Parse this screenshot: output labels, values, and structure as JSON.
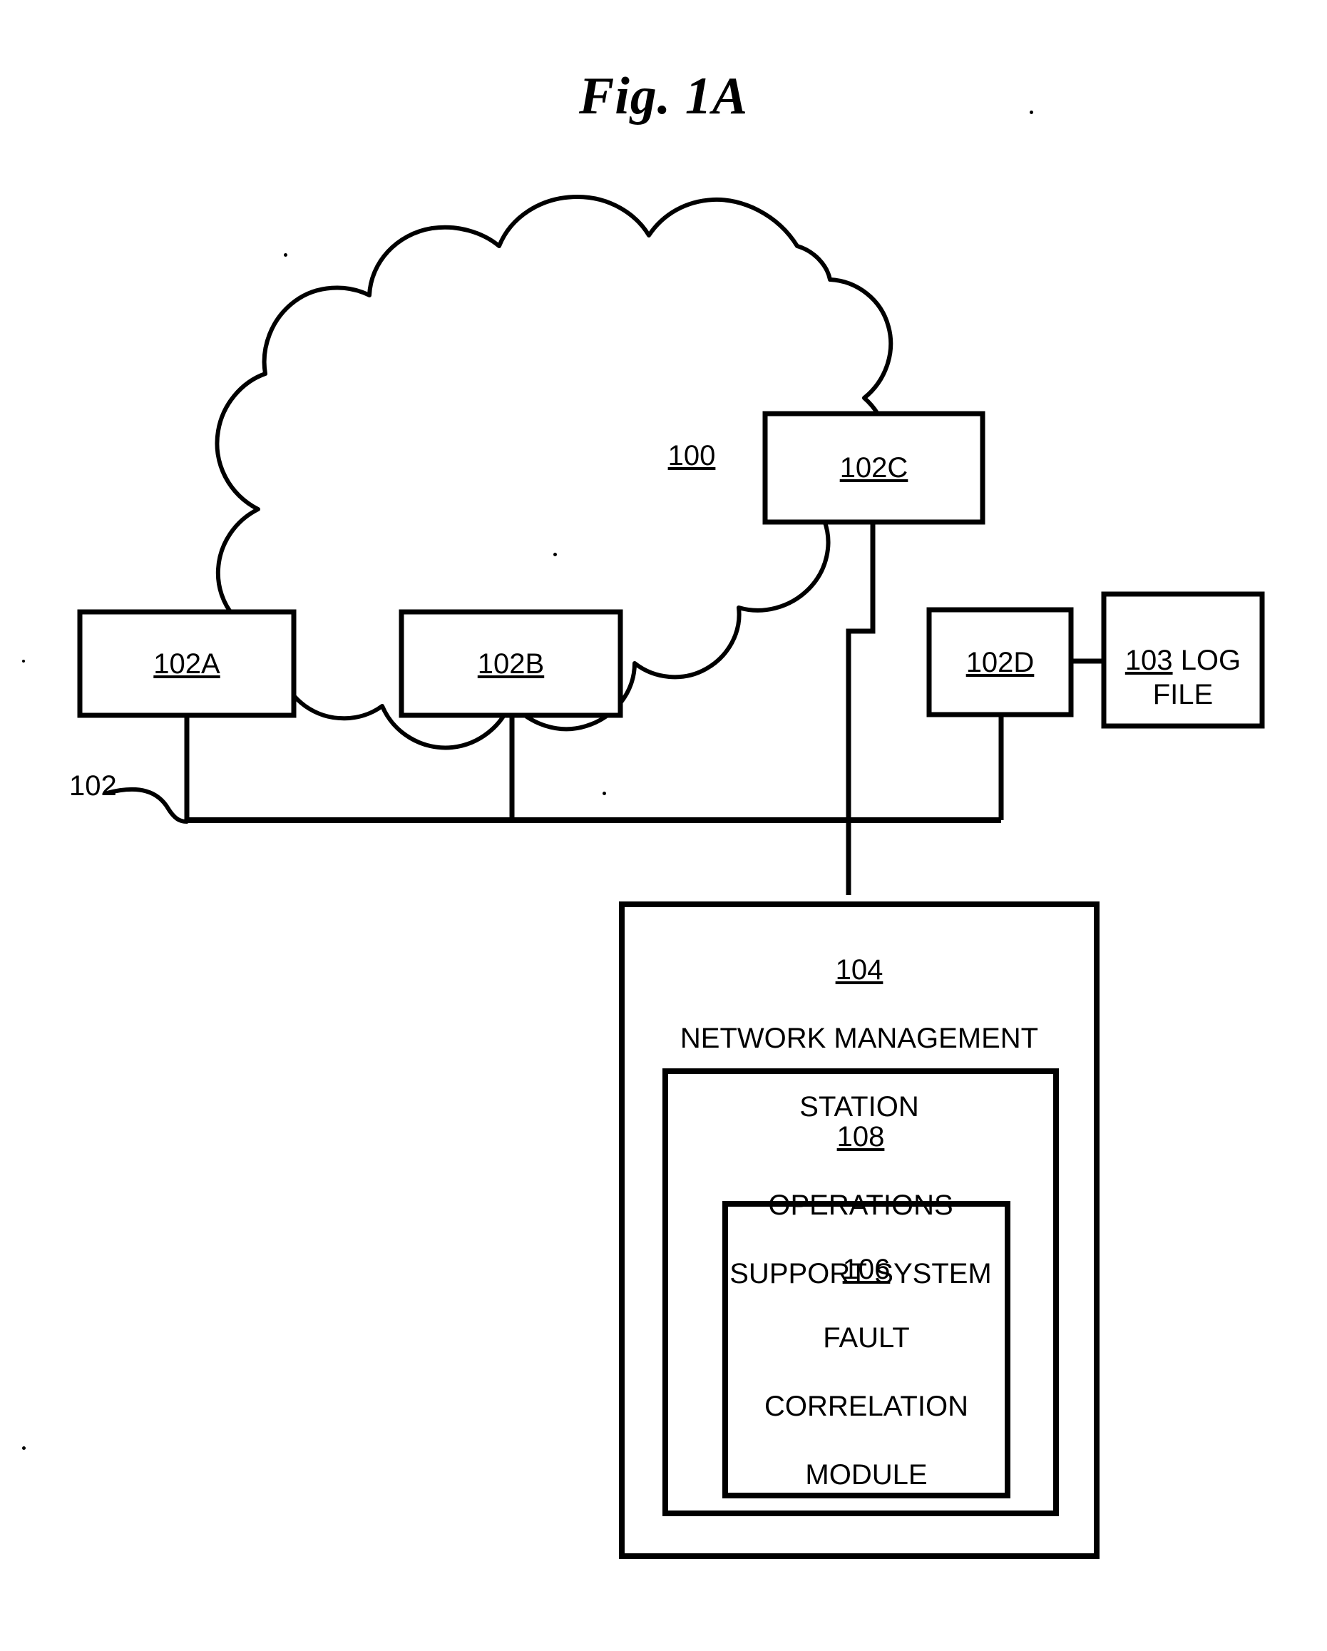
{
  "figure": {
    "title": "Fig. 1A",
    "ink_color": "#000000",
    "background_color": "#ffffff"
  },
  "nodes": {
    "cloud": {
      "ref": "100",
      "name": "network-cloud",
      "label": ""
    },
    "node_102a": {
      "ref": "102A",
      "label": ""
    },
    "node_102b": {
      "ref": "102B",
      "label": ""
    },
    "node_102c": {
      "ref": "102C",
      "label": ""
    },
    "node_102d": {
      "ref": "102D",
      "label": ""
    },
    "log_file": {
      "ref": "103",
      "label": "LOG",
      "label_line2": "FILE",
      "full": "103 LOG FILE"
    },
    "bus": {
      "ref": "102"
    },
    "network_management_station": {
      "ref": "104",
      "label_line1": "NETWORK MANAGEMENT",
      "label_line2": "STATION"
    },
    "operations_support_system": {
      "ref": "108",
      "label_line1": "OPERATIONS",
      "label_line2": "SUPPORT SYSTEM"
    },
    "fault_correlation_module": {
      "ref": "106",
      "label_line1": "FAULT",
      "label_line2": "CORRELATION",
      "label_line3": "MODULE"
    }
  }
}
